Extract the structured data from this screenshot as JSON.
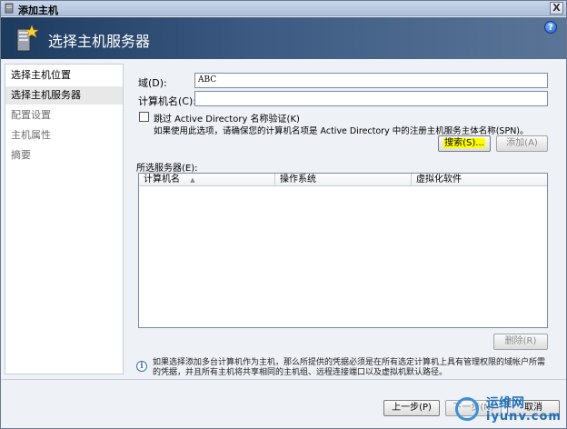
{
  "window": {
    "title": "添加主机",
    "close_label": "X"
  },
  "banner": {
    "title": "选择主机服务器",
    "help_label": "?"
  },
  "sidebar": {
    "items": [
      {
        "label": "选择主机位置",
        "state": "active"
      },
      {
        "label": "选择主机服务器",
        "state": "current"
      },
      {
        "label": "配置设置",
        "state": "disabled"
      },
      {
        "label": "主机属性",
        "state": "disabled"
      },
      {
        "label": "摘要",
        "state": "disabled"
      }
    ]
  },
  "form": {
    "domain_label": "域(D):",
    "domain_value": "ABC",
    "computer_label": "计算机名(C):",
    "computer_value": "",
    "skip_ad_label": "跳过 Active Directory 名称验证(K)",
    "skip_ad_checked": false,
    "skip_ad_hint": "如果使用此选项，请确保您的计算机名项是 Active Directory 中的注册主机服务主体名称(SPN)。",
    "search_button": "搜索(S)...",
    "add_button": "添加(A)"
  },
  "selected": {
    "label": "所选服务器(E):",
    "columns": [
      "计算机名",
      "操作系统",
      "虚拟化软件"
    ],
    "rows": [],
    "remove_button": "删除(R)"
  },
  "info": {
    "text": "如果选择添加多台计算机作为主机，那么所提供的凭据必须是在所有选定计算机上具有管理权限的域帐户所需的凭据，并且所有主机将共享相同的主机组、远程连接端口以及虚拟机默认路径。"
  },
  "footer": {
    "prev_button": "上一步(P)",
    "next_button": "下一步(N)",
    "cancel_button": "取消"
  },
  "watermark": {
    "text1": "运维网",
    "text2": "iyunv.com"
  }
}
